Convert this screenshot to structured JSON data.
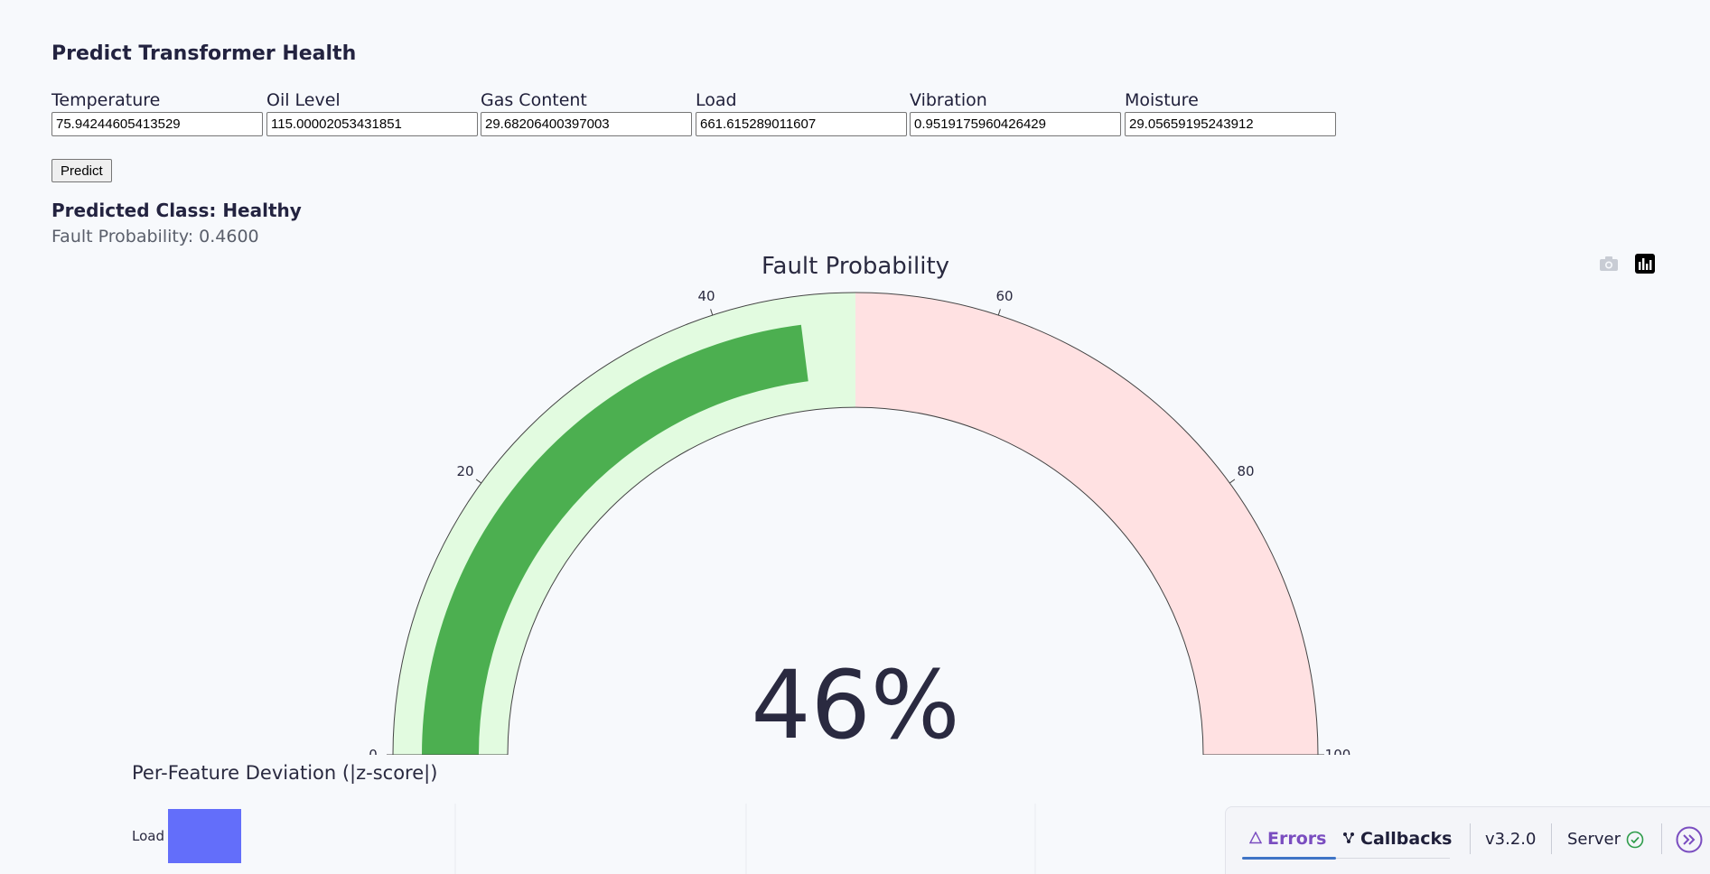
{
  "page": {
    "title": "Predict Transformer Health"
  },
  "inputs": [
    {
      "label": "Temperature",
      "value": "75.94244605413529"
    },
    {
      "label": "Oil Level",
      "value": "115.00002053431851"
    },
    {
      "label": "Gas Content",
      "value": "29.68206400397003"
    },
    {
      "label": "Load",
      "value": "661.615289011607"
    },
    {
      "label": "Vibration",
      "value": "0.9519175960426429"
    },
    {
      "label": "Moisture",
      "value": "29.05659195243912"
    }
  ],
  "predict_button": {
    "label": "Predict"
  },
  "result": {
    "predicted_class": "Predicted Class: Healthy",
    "fault_probability": "Fault Probability: 0.4600"
  },
  "modebar": {
    "icons": [
      "camera-icon",
      "plotly-logo-icon"
    ]
  },
  "chart_data": [
    {
      "type": "gauge",
      "title": "Fault Probability",
      "value": 46,
      "value_text": "46%",
      "range": [
        0,
        100
      ],
      "ticks": [
        "0",
        "20",
        "40",
        "60",
        "80",
        "100"
      ],
      "tick_values": [
        0,
        20,
        40,
        60,
        80,
        100
      ],
      "steps": [
        {
          "range": [
            0,
            50
          ],
          "color": "#e2fbe0"
        },
        {
          "range": [
            50,
            100
          ],
          "color": "#ffe1e2"
        }
      ],
      "bar_color": "#4caf50"
    },
    {
      "type": "bar",
      "orientation": "horizontal",
      "title": "Per-Feature Deviation (|z-score|)",
      "categories": [
        "Load"
      ],
      "bar_color": "#636efa"
    }
  ],
  "devtools": {
    "errors_label": "Errors",
    "callbacks_label": "Callbacks",
    "version": "v3.2.0",
    "server_label": "Server",
    "accent": "#7a4dc0"
  }
}
